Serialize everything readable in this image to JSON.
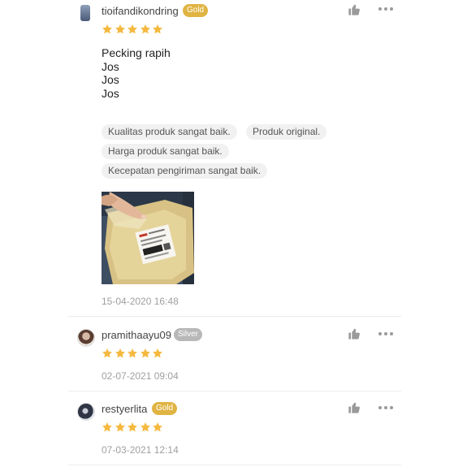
{
  "reviews": [
    {
      "username": "tioifandikondring",
      "badge": "Gold",
      "rating": 5,
      "text_lines": [
        "Pecking rapih",
        "Jos",
        "Jos",
        "Jos"
      ],
      "tags": [
        "Kualitas produk sangat baik.",
        "Produk original.",
        "Harga produk sangat baik.",
        "Kecepatan pengiriman sangat baik."
      ],
      "date": "15-04-2020 16:48"
    },
    {
      "username": "pramithaayu09",
      "badge": "Silver",
      "rating": 5,
      "date": "02-07-2021 09:04"
    },
    {
      "username": "restyerlita",
      "badge": "Gold",
      "rating": 5,
      "date": "07-03-2021 12:14"
    }
  ],
  "colors": {
    "star": "#f5b940",
    "gold_badge": "#e0b443",
    "silver_badge": "#b8b8b8",
    "icon_gray": "#9a9a9a"
  },
  "icons": [
    "thumbs-up-icon",
    "more-options-icon",
    "star-icon"
  ]
}
